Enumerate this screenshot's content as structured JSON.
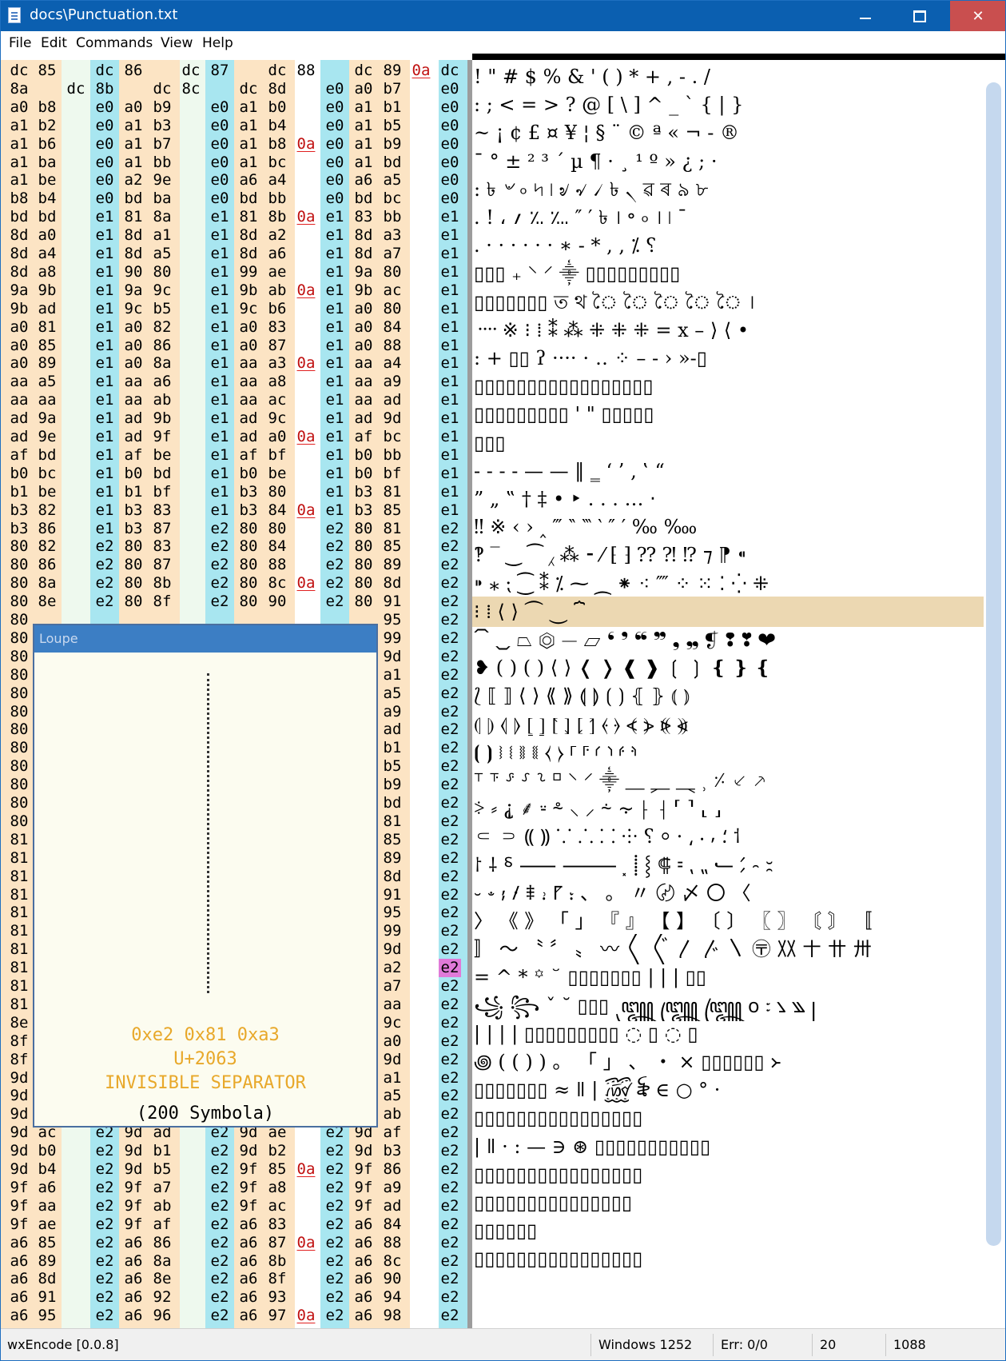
{
  "window": {
    "title": "docs\\Punctuation.txt",
    "min_label": "",
    "max_label": "",
    "close_label": "✕"
  },
  "menu": {
    "items": [
      {
        "label": "File",
        "key": "F"
      },
      {
        "label": "Edit",
        "key": "E"
      },
      {
        "label": "Commands",
        "key": "C"
      },
      {
        "label": "View",
        "key": "V"
      },
      {
        "label": "Help",
        "key": "H"
      }
    ]
  },
  "colors": {
    "stripe_orange": "#fce4c4",
    "stripe_cyan": "#a8e6f0",
    "stripe_mint": "#eef9ee",
    "line_feed": "#c01010",
    "highlight_magenta": "#e07ad8",
    "selected_glyph_row": "#ecd8b2",
    "loupe_text": "#e8a82a"
  },
  "hex_rows": [
    "dc 85 _ dc 86 _ dc 87 _ dc 88 _ dc 89 0a dc",
    "8a _ dc 8b _ dc 8c _ dc 8d _ e0 a0 b7 _ e0",
    "a0 b8 _ e0 a0 b9 _ e0 a1 b0 _ e0 a1 b1 _ e0",
    "a1 b2 _ e0 a1 b3 _ e0 a1 b4 _ e0 a1 b5 _ e0",
    "a1 b6 _ e0 a1 b7 _ e0 a1 b8 0a e0 a1 b9 _ e0",
    "a1 ba _ e0 a1 bb _ e0 a1 bc _ e0 a1 bd _ e0",
    "a1 be _ e0 a2 9e _ e0 a6 a4 _ e0 a6 a5 _ e0",
    "b8 b4 _ e0 bd ba _ e0 bd bb _ e0 bd bc _ e0",
    "bd bd _ e1 81 8a _ e1 81 8b 0a e1 83 bb _ e1",
    "8d a0 _ e1 8d a1 _ e1 8d a2 _ e1 8d a3 _ e1",
    "8d a4 _ e1 8d a5 _ e1 8d a6 _ e1 8d a7 _ e1",
    "8d a8 _ e1 90 80 _ e1 99 ae _ e1 9a 80 _ e1",
    "9a 9b _ e1 9a 9c _ e1 9b ab 0a e1 9b ac _ e1",
    "9b ad _ e1 9c b5 _ e1 9c b6 _ e1 a0 80 _ e1",
    "a0 81 _ e1 a0 82 _ e1 a0 83 _ e1 a0 84 _ e1",
    "a0 85 _ e1 a0 86 _ e1 a0 87 _ e1 a0 88 _ e1",
    "a0 89 _ e1 a0 8a _ e1 aa a3 0a e1 aa a4 _ e1",
    "aa a5 _ e1 aa a6 _ e1 aa a8 _ e1 aa a9 _ e1",
    "aa aa _ e1 aa ab _ e1 aa ac _ e1 aa ad _ e1",
    "ad 9a _ e1 ad 9b _ e1 ad 9c _ e1 ad 9d _ e1",
    "ad 9e _ e1 ad 9f _ e1 ad a0 0a e1 af bc _ e1",
    "af bd _ e1 af be _ e1 af bf _ e1 b0 bb _ e1",
    "b0 bc _ e1 b0 bd _ e1 b0 be _ e1 b0 bf _ e1",
    "b1 be _ e1 b1 bf _ e1 b3 80 _ e1 b3 81 _ e1",
    "b3 82 _ e1 b3 83 _ e1 b3 84 0a e1 b3 85 _ e1",
    "b3 86 _ e1 b3 87 _ e2 80 80 _ e2 80 81 _ e2",
    "80 82 _ e2 80 83 _ e2 80 84 _ e2 80 85 _ e2",
    "80 86 _ e2 80 87 _ e2 80 88 _ e2 80 89 _ e2",
    "80 8a _ e2 80 8b _ e2 80 8c 0a e2 80 8d _ e2",
    "80 8e _ e2 80 8f _ e2 80 90 _ e2 80 91 _ e2",
    "80 _ _ _ _ _ _ _ _ _ _ _ _ 95 _ e2",
    "80 _ _ _ _ _ _ _ _ _ _ _ _ 99 _ e2",
    "80 _ _ _ _ _ _ _ _ _ _ _ _ 9d _ e2",
    "80 _ _ _ _ _ _ _ _ _ _ _ _ a1 _ e2",
    "80 _ _ _ _ _ _ _ _ _ _ _ _ a5 _ e2",
    "80 _ _ _ _ _ _ _ _ _ _ _ _ a9 _ e2",
    "80 _ _ _ _ _ _ _ _ _ _ _ _ ad _ e2",
    "80 _ _ _ _ _ _ _ _ _ _ _ _ b1 _ e2",
    "80 _ _ _ _ _ _ _ _ _ _ _ _ b5 _ e2",
    "80 _ _ _ _ _ _ _ _ _ _ _ _ b9 _ e2",
    "80 _ _ _ _ _ _ _ _ _ _ _ _ bd _ e2",
    "80 _ _ _ _ _ _ _ _ _ _ _ _ 81 _ e2",
    "81 _ _ _ _ _ _ _ _ _ _ _ _ 85 _ e2",
    "81 _ _ _ _ _ _ _ _ _ _ _ _ 89 _ e2",
    "81 _ _ _ _ _ _ _ _ _ _ _ _ 8d _ e2",
    "81 _ _ _ _ _ _ _ _ _ _ _ _ 91 _ e2",
    "81 _ _ _ _ _ _ _ _ _ _ _ _ 95 _ e2",
    "81 _ _ _ _ _ _ _ _ _ _ _ _ 99 _ e2",
    "81 _ _ _ _ _ _ _ _ _ _ _ _ 9d _ e2",
    "81 _ _ _ _ _ _ _ _ _ _ _ _ a2 _ e2",
    "81 _ _ _ _ _ _ _ _ _ _ _ _ a7 _ e2",
    "81 _ _ _ _ _ _ _ _ _ _ _ _ aa _ e2",
    "8e _ _ _ _ _ _ _ _ _ _ _ _ 9c _ e2",
    "8f _ _ _ _ _ _ _ _ _ _ _ _ a0 _ e2",
    "8f _ _ _ _ _ _ _ _ _ _ _ _ 9d _ e2",
    "9d _ _ _ _ _ _ _ _ _ _ _ _ a1 _ e2",
    "9d _ _ _ _ _ _ _ _ _ _ _ _ a5 _ e2",
    "9d _ _ _ _ _ _ _ _ _ _ _ _ ab _ e2",
    "9d ac _ e2 9d ad _ e2 9d ae _ e2 9d af _ e2",
    "9d b0 _ e2 9d b1 _ e2 9d b2 _ e2 9d b3 _ e2",
    "9d b4 _ e2 9d b5 _ e2 9f 85 0a e2 9f 86 _ e2",
    "9f a6 _ e2 9f a7 _ e2 9f a8 _ e2 9f a9 _ e2",
    "9f aa _ e2 9f ab _ e2 9f ac _ e2 9f ad _ e2",
    "9f ae _ e2 9f af _ e2 a6 83 _ e2 a6 84 _ e2",
    "a6 85 _ e2 a6 86 _ e2 a6 87 0a e2 a6 88 _ e2",
    "a6 89 _ e2 a6 8a _ e2 a6 8b _ e2 a6 8c _ e2",
    "a6 8d _ e2 a6 8e _ e2 a6 8f _ e2 a6 90 _ e2",
    "a6 91 _ e2 a6 92 _ e2 a6 93 _ e2 a6 94 _ e2",
    "a6 95 _ e2 a6 96 _ e2 a6 97 0a e2 a6 98 _ e2"
  ],
  "highlight_cell": {
    "row": 49,
    "col": 15
  },
  "glyph_rows": [
    " ! \" # $ % & ' ( ) * + , - . /",
    ": ; < = > ? @ [ \\ ] ^ _ ` { | }",
    "~  ¡ ¢ £ ¤ ¥ ¦ § ¨ © ª « ¬ - ®",
    "¯ ° ± ² ³ ´ µ ¶ · ¸ ¹ º » ¿ ; ·",
    ": ৳ ৺ ৹ ৸ ৷ ৶ ৵ ৴ ৳ ৲ ৱ ৰ ৯ ৮",
    ". ! ، ؍ ؉ ؊ ″ ′ ৳ । ॰ ৹ । ৷ ¯",
    ". · · · · · · ∗ ‐ * , , ⁒ ⸮",
    "▯▯▯ ₊ ⸌ ⸍ ⸎ ▯▯▯▯▯▯▯▯▯",
    "▯▯▯▯▯▯▯ ত থ ৈ ৈ ৈ ৈ ৈ ।",
    "᠁ ※ ⁝ ⁞ ⁑ ⁂ ⁜ ⁜ ⁜ = x – ⟩ ⟨ •",
    ": + ▯▯ ʔ ···· ⋅ ‥ ⁘ – ‐ › »-▯",
    "▯▯▯▯▯▯▯▯▯▯▯▯▯▯▯▯▯",
    "▯▯▯▯▯▯▯▯▯ ' \" ▯▯▯▯▯",
    "▯▯▯",
    "  - - - - — — ‖ ‗ ‘ ’ ‚ ‛ “",
    "” „ ‟ † ‡ • ‣ . . . … ‧",
    " ‼ ※ ‹ › ‸ ‴ ‶ ‷ ‵ ″ ′ ‰ ‱",
    "‽ ‾ ‿ ⁀ ⁁ ⁂ ⁃ ⁄ ⁅ ⁆ ⁇ ⁈ ⁉ ⁊ ⁋ ⁌",
    "⁍ ⁎ ⁏ ⁐ ⁑ ⁒ ⁓ ⁔ ⁕ ⁖ ⁗ ⁘ ⁙ ⁚ ⁛ ⁜",
    "⁝ ⁞          ⟨ ⟩ ⏜ ⏝ ⏞",
    "⏠ ⏡ ⏢ ⏣ ⏤ ⏥ ❛ ❜ ❝ ❞ ❟ ❠ ❡ ❢ ❣ ❤",
    "❥ ( ) ( ) ⟨ ⟩ ❬ ❭ ❰ ❱ ❲ ❳ ❴ ❵ ❴",
    "⟅ ⟦ ⟧ ⟨ ⟩ ⟪ ⟫ ⟬ ⟭ ⟮ ⟯ ⦃ ⦄ ⦅ ⦆",
    "⦇ ⦈ ⦉ ⦊ ⦋ ⦌ ⦍ ⦎ ⦏ ⦐ ⦑ ⦒ ⦓ ⦔ ⦕ ⦖",
    "⦗ ⦘ ⧘ ⧙ ⧚ ⧛ ⧼ ⧽ ⸀ ⸁ ⸂ ⸃ ⸄ ⸅",
    "⸆ ⸇ ⸈ ⸉ ⸊ ⸋ ⸌ ⸍ ⸎ ⸏ ⸐ ⸑ ⸒ ⸓ ⸔ ⸕",
    "⸖ ⸗ ⸘ ⸙ ⸚ ⸛ ⸜ ⸝ ⸞ ⸟ ⸠ ⸡ ⸢ ⸣ ⸤ ⸥",
    "⸦ ⸧ ⸨ ⸩ ⸪ ⸫ ⸬ ⸭ ⸮ ⸰ ⸱ ⸲ ⸳ ⸴ ⸵ ⸶",
    "⸷ ⸸ ⸹ ⸺ ⸻ ⸼ ⸽ ⸾ ⸿ ⹀ ⹁ ⹂ ⹃ ⹄ ⹅ ⹆",
    "⹇ ⹈ ⹉ ⹊ ⹋ ⹌ ⹍ ⹎ 、 。 〃 〄 〆 〇 〈",
    "〉 《 》 「 」 『 』 【 】 〔 〕 〖 〗 〘 〙 〚",
    "〛 〜 〝 〞 〟 〰 〱 〲 〳 〴 〵 〶 〷 〸 〹 〺",
    "= ^ * ꙳ ꙾ ▯▯▯▯▯▯▯ | | | ▯▯",
    "꧁ ꧂ ˇ ˘ ▯▯▯ ꧃ ꧄ ꧅ ꧆ ꧇ ꧈ ꧉ ꧊",
    "| | | | ▯▯▯▯▯▯▯▯▯ ◌ ▯ ◌ ▯",
    "꩜ ( ( ) ) 。 「 」 、 ・ × ▯▯▯▯▯▯ ᚛",
    "▯▯▯▯▯▯▯ ≈ ǁ | ꫞ ꫟ ∈ ○ ° ·",
    "▯▯▯▯▯▯▯▯▯▯▯▯▯▯▯▯",
    "| ǁ · : — ∋ ⊛ ▯▯▯▯▯▯▯▯▯▯▯",
    "▯▯▯▯▯▯▯▯▯▯▯▯▯▯▯▯",
    "▯▯▯▯▯▯▯▯▯▯▯▯▯▯▯",
    "      ▯▯▯▯▯▯",
    "▯▯▯▯▯▯▯▯▯▯▯▯▯▯▯▯"
  ],
  "selected_glyph_row": 19,
  "loupe": {
    "title": "Loupe",
    "bytes": "0xe2 0x81 0xa3",
    "codepoint": "U+2063",
    "name": "INVISIBLE SEPARATOR",
    "font": "(200 Symbola)"
  },
  "status": {
    "app": "wxEncode [0.0.8]",
    "encoding": "Windows 1252",
    "errors": "Err: 0/0",
    "column": "20",
    "offset": "1088"
  }
}
